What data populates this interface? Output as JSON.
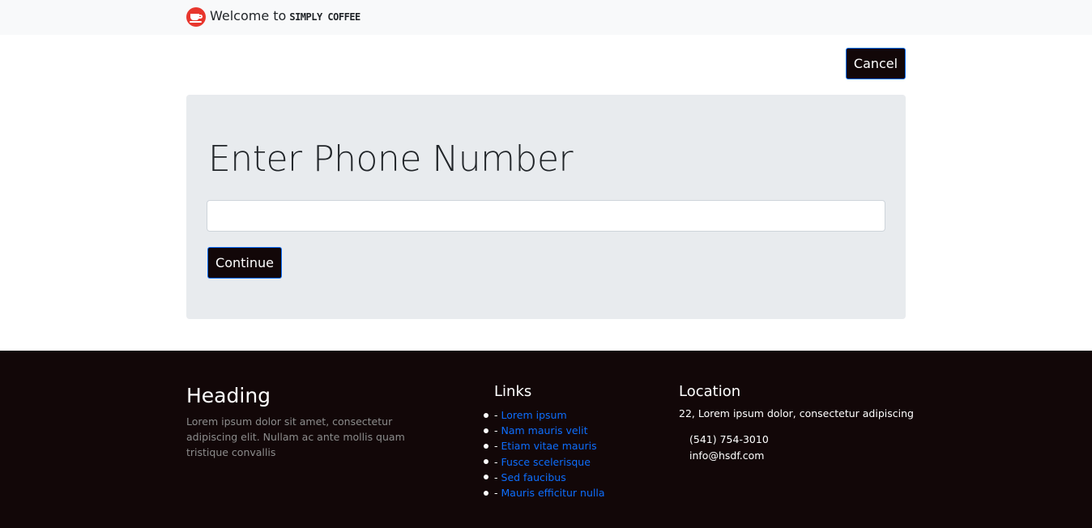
{
  "navbar": {
    "welcome": "Welcome to",
    "brand_name": "SIMPLY COFFEE",
    "logo_icon": "coffee-cup-icon"
  },
  "actions": {
    "cancel_label": "Cancel"
  },
  "form": {
    "title": "Enter Phone Number",
    "phone_value": "",
    "phone_placeholder": "",
    "continue_label": "Continue"
  },
  "footer": {
    "heading": "Heading",
    "text": "Lorem ipsum dolor sit amet, consectetur adipiscing elit. Nullam ac ante mollis quam tristique convallis",
    "links_title": "Links",
    "links": [
      {
        "prefix": "-",
        "label": "Lorem ipsum"
      },
      {
        "prefix": "-",
        "label": "Nam mauris velit"
      },
      {
        "prefix": "-",
        "label": "Etiam vitae mauris"
      },
      {
        "prefix": "-",
        "label": "Fusce scelerisque"
      },
      {
        "prefix": "-",
        "label": "Sed faucibus"
      },
      {
        "prefix": "-",
        "label": "Mauris efficitur nulla"
      }
    ],
    "location_title": "Location",
    "address": "22, Lorem ipsum dolor, consectetur adipiscing",
    "phone": "(541) 754-3010",
    "email": "info@hsdf.com"
  },
  "colors": {
    "navbar_bg": "#f8f9fa",
    "dark": "#120708",
    "panel_bg": "#e8ebee",
    "link": "#0d6efd",
    "logo": "#e8362d"
  }
}
